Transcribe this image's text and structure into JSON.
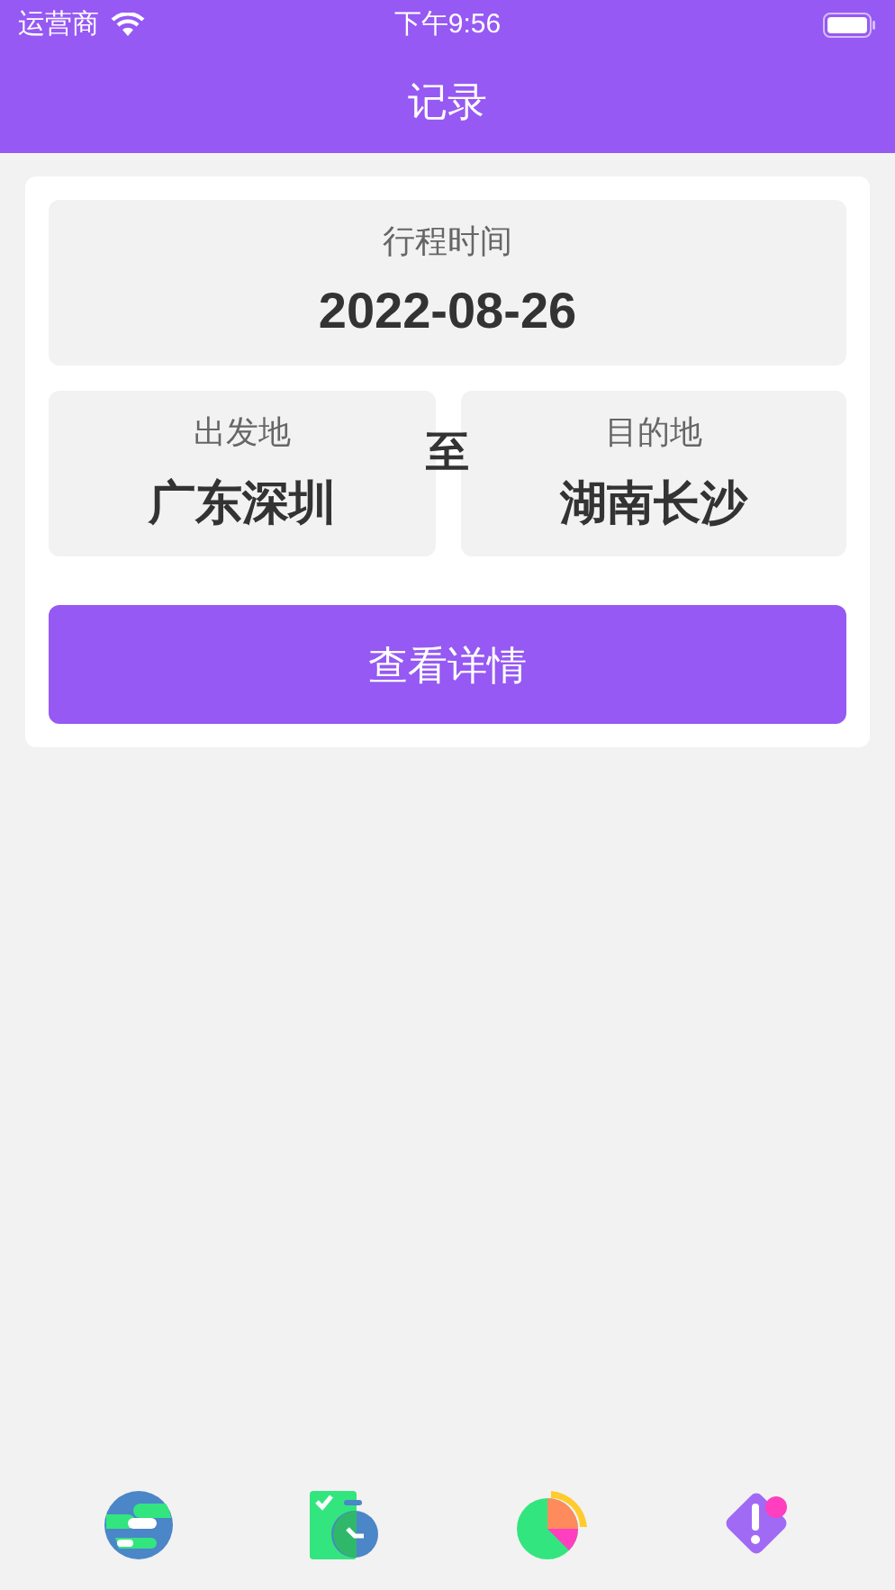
{
  "status_bar": {
    "carrier": "运营商",
    "time": "下午9:56"
  },
  "nav_bar": {
    "title": "记录"
  },
  "record": {
    "time_label": "行程时间",
    "date": "2022-08-26",
    "origin_label": "出发地",
    "origin": "广东深圳",
    "separator": "至",
    "destination_label": "目的地",
    "destination": "湖南长沙",
    "button": "查看详情"
  },
  "tab_bar": [
    {
      "kind": "globe"
    },
    {
      "kind": "timer"
    },
    {
      "kind": "pie"
    },
    {
      "kind": "alert"
    }
  ]
}
